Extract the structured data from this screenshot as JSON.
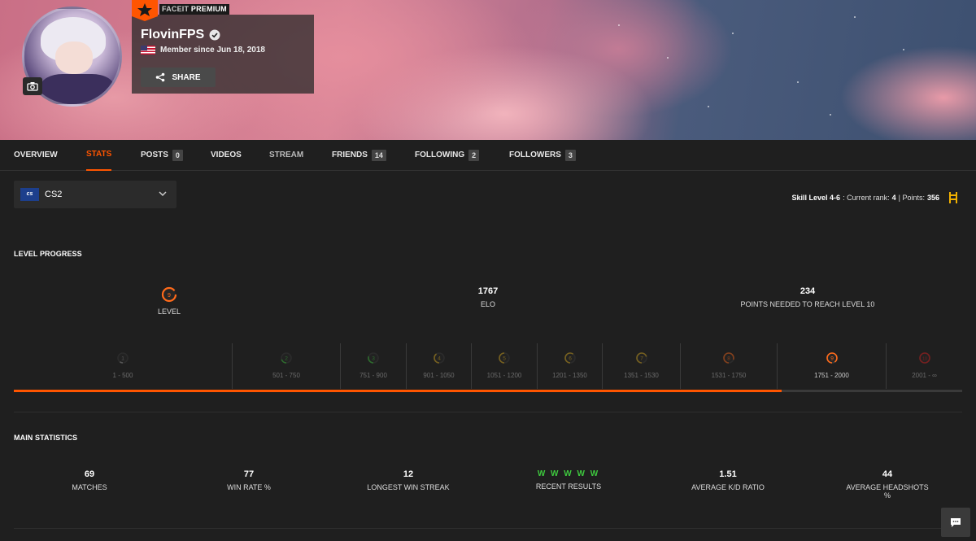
{
  "profile": {
    "premium_brand": "FACEIT",
    "premium_label": "PREMIUM",
    "username": "FlovinFPS",
    "member_since": "Member since Jun 18, 2018",
    "share_label": "SHARE"
  },
  "tabs": [
    {
      "label": "OVERVIEW",
      "count": null
    },
    {
      "label": "STATS",
      "count": null
    },
    {
      "label": "POSTS",
      "count": "0"
    },
    {
      "label": "VIDEOS",
      "count": null
    },
    {
      "label": "STREAM",
      "count": null
    },
    {
      "label": "FRIENDS",
      "count": "14"
    },
    {
      "label": "FOLLOWING",
      "count": "2"
    },
    {
      "label": "FOLLOWERS",
      "count": "3"
    }
  ],
  "game_select": {
    "logo_text": "cs",
    "value": "CS2"
  },
  "skill_info": {
    "prefix": "Skill Level 4-6",
    "rank_label": ": Current rank: ",
    "rank": "4",
    "points_label": " | Points: ",
    "points": "356"
  },
  "level_progress": {
    "title": "LEVEL PROGRESS",
    "level": "9",
    "level_label": "LEVEL",
    "elo": "1767",
    "elo_label": "ELO",
    "points_needed": "234",
    "points_needed_label": "POINTS NEEDED TO REACH LEVEL 10",
    "progress_fraction": 0.81,
    "levels": [
      {
        "n": "1",
        "range": "1 - 500",
        "color": "#9a9a9a"
      },
      {
        "n": "2",
        "range": "501 - 750",
        "color": "#3ec83e"
      },
      {
        "n": "3",
        "range": "751 - 900",
        "color": "#3ec83e"
      },
      {
        "n": "4",
        "range": "901 - 1050",
        "color": "#e0b020"
      },
      {
        "n": "5",
        "range": "1051 - 1200",
        "color": "#e0b020"
      },
      {
        "n": "6",
        "range": "1201 - 1350",
        "color": "#e0b020"
      },
      {
        "n": "7",
        "range": "1351 - 1530",
        "color": "#e0b020"
      },
      {
        "n": "8",
        "range": "1531 - 1750",
        "color": "#ff6a1a"
      },
      {
        "n": "9",
        "range": "1751 - 2000",
        "color": "#ff6a1a"
      },
      {
        "n": "10",
        "range": "2001 - ∞",
        "color": "#e02020"
      }
    ]
  },
  "main_statistics": {
    "title": "MAIN STATISTICS",
    "items": [
      {
        "value": "69",
        "label": "MATCHES"
      },
      {
        "value": "77",
        "label": "WIN RATE %"
      },
      {
        "value": "12",
        "label": "LONGEST WIN STREAK"
      },
      {
        "value": "W W W W W",
        "label": "RECENT RESULTS"
      },
      {
        "value": "1.51",
        "label": "AVERAGE K/D RATIO"
      },
      {
        "value": "44",
        "label": "AVERAGE HEADSHOTS %"
      }
    ]
  },
  "colors": {
    "accent": "#ff5500",
    "win": "#3ec83e",
    "background": "#1f1f1f"
  }
}
